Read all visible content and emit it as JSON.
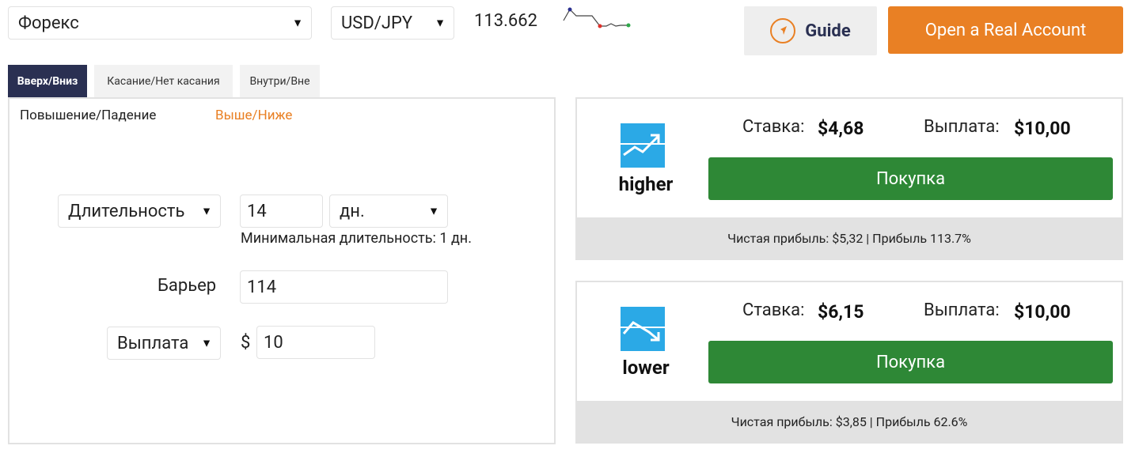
{
  "market_select": {
    "value": "Форекс"
  },
  "symbol_select": {
    "value": "USD/JPY"
  },
  "spot_price": "113.662",
  "header": {
    "guide_label": "Guide",
    "real_account_label": "Open a Real Account"
  },
  "tabs": [
    {
      "label": "Вверх/Вниз",
      "active": true
    },
    {
      "label": "Касание/Нет касания",
      "active": false
    },
    {
      "label": "Внутри/Вне",
      "active": false
    }
  ],
  "subtabs": [
    {
      "label": "Повышение/Падение",
      "active": false
    },
    {
      "label": "Выше/Ниже",
      "active": true
    }
  ],
  "form": {
    "duration_type": "Длительность",
    "duration_value": "14",
    "duration_unit": "дн.",
    "min_duration_hint": "Минимальная длительность: 1 дн.",
    "barrier_label": "Барьер",
    "barrier_value": "114",
    "amount_type": "Выплата",
    "currency_symbol": "$",
    "amount_value": "10"
  },
  "contracts": [
    {
      "name": "higher",
      "icon": "arrow-up-trend-icon",
      "stake_label": "Ставка:",
      "stake_value": "$4,68",
      "payout_label": "Выплата:",
      "payout_value": "$10,00",
      "buy_label": "Покупка",
      "footer": "Чистая прибыль: $5,32 | Прибыль 113.7%"
    },
    {
      "name": "lower",
      "icon": "arrow-down-trend-icon",
      "stake_label": "Ставка:",
      "stake_value": "$6,15",
      "payout_label": "Выплата:",
      "payout_value": "$10,00",
      "buy_label": "Покупка",
      "footer": "Чистая прибыль: $3,85 | Прибыль 62.6%"
    }
  ],
  "colors": {
    "accent_orange": "#e98024",
    "navy": "#2a3052",
    "buy_green": "#2e8836",
    "icon_blue": "#2ba9e6"
  }
}
